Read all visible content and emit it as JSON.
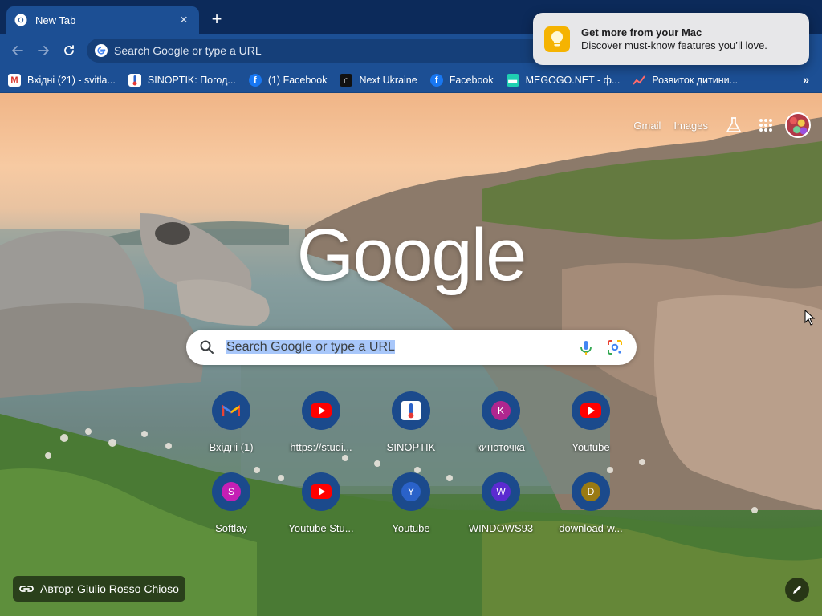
{
  "tab": {
    "title": "New Tab",
    "close": "×"
  },
  "toolbar": {
    "omnibox_placeholder": "Search Google or type a URL"
  },
  "bookmarks": [
    {
      "label": "Вхідні (21) - svitla...",
      "icon": "gmail-icon"
    },
    {
      "label": "SINOPTIK: Погод...",
      "icon": "sinoptik-icon"
    },
    {
      "label": "(1) Facebook",
      "icon": "facebook-icon"
    },
    {
      "label": "Next Ukraine",
      "icon": "next-ukraine-icon"
    },
    {
      "label": "Facebook",
      "icon": "facebook-icon"
    },
    {
      "label": "MEGOGO.NET - ф...",
      "icon": "megogo-icon"
    },
    {
      "label": "Розвиток дитини...",
      "icon": "chart-icon"
    }
  ],
  "bookmarks_overflow": "»",
  "ntp": {
    "links": {
      "gmail": "Gmail",
      "images": "Images"
    },
    "logo": "Google",
    "search_text": "Search Google or type a URL",
    "attribution": "Автор: Giulio Rosso Chioso"
  },
  "shortcuts": [
    {
      "label": "Вхідні (1)",
      "icon": "gmail-icon"
    },
    {
      "label": "https://studi...",
      "icon": "youtube-icon"
    },
    {
      "label": "SINOPTIK",
      "icon": "sinoptik-icon"
    },
    {
      "label": "киноточка",
      "icon": "letter-k-icon",
      "letter": "K",
      "color": "#b0268f"
    },
    {
      "label": "Youtube",
      "icon": "youtube-icon"
    },
    {
      "label": "Softlay",
      "icon": "letter-s-icon",
      "letter": "S",
      "color": "#c51fb5"
    },
    {
      "label": "Youtube Stu...",
      "icon": "youtube-icon"
    },
    {
      "label": "Youtube",
      "icon": "letter-y-icon",
      "letter": "Y",
      "color": "#2a62c9"
    },
    {
      "label": "WINDOWS93",
      "icon": "letter-w-icon",
      "letter": "W",
      "color": "#5b2bd0"
    },
    {
      "label": "download-w...",
      "icon": "letter-d-icon",
      "letter": "D",
      "color": "#9a7a12"
    }
  ],
  "notification": {
    "title": "Get more from your Mac",
    "body": "Discover must-know features you’ll love."
  },
  "colors": {
    "frame": "#1c4f94",
    "tabstrip": "#0c2a5a",
    "shortcut_bg": "#1b4a8c"
  }
}
